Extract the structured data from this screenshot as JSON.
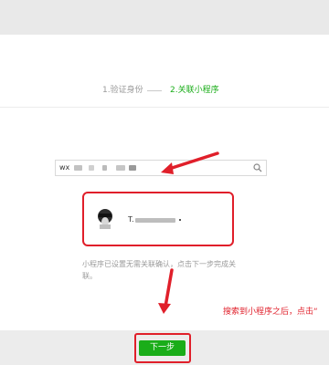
{
  "steps": {
    "step1": "1.验证身份",
    "step2": "2.关联小程序"
  },
  "search": {
    "value": "wx"
  },
  "result": {
    "name_prefix": "T."
  },
  "note": "小程序已设置无需关联确认，点击下一步完成关联。",
  "next_button": "下一步",
  "annotation": "搜索到小程序之后，点击“",
  "colors": {
    "accent_green": "#1aad19",
    "annotation_red": "#e01f2a"
  }
}
